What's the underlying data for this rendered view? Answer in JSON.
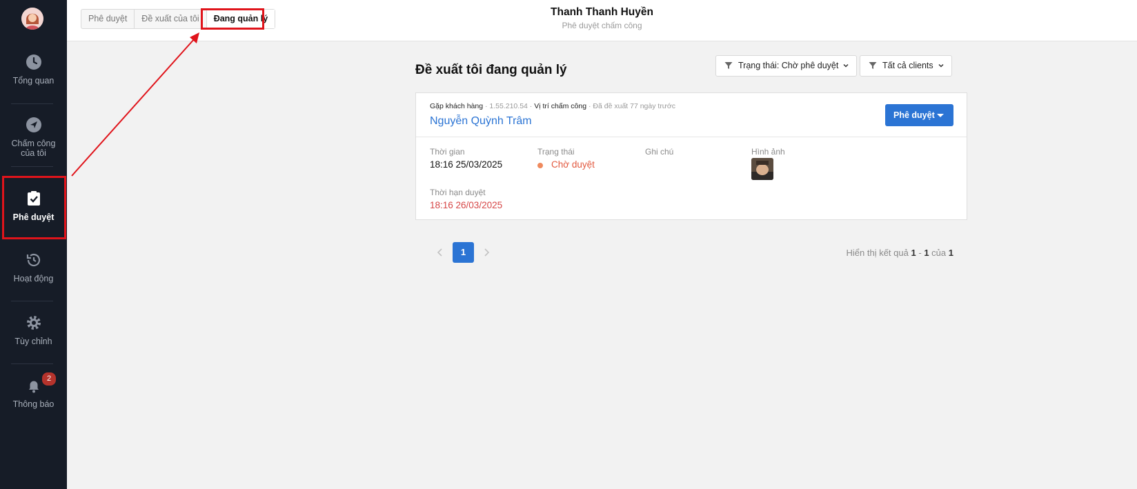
{
  "sidebar": {
    "items": [
      {
        "label": "Tổng quan",
        "icon": "clock-icon"
      },
      {
        "label": "Chấm công của tôi",
        "icon": "navigation-icon"
      },
      {
        "label": "Phê duyệt",
        "icon": "clipboard-check-icon"
      },
      {
        "label": "Hoạt động",
        "icon": "history-icon"
      },
      {
        "label": "Tùy chỉnh",
        "icon": "gear-icon"
      },
      {
        "label": "Thông báo",
        "icon": "bell-icon"
      }
    ],
    "notification_count": "2"
  },
  "header": {
    "tabs": [
      {
        "label": "Phê duyệt"
      },
      {
        "label": "Đề xuất của tôi"
      },
      {
        "label": "Đang quản lý"
      }
    ],
    "user_name": "Thanh Thanh Huyền",
    "user_subtitle": "Phê duyệt chấm công"
  },
  "main": {
    "title": "Đề xuất tôi đang quản lý",
    "filters": {
      "status": "Trạng thái: Chờ phê duyệt",
      "clients": "Tất cả clients"
    },
    "card": {
      "category": "Gặp khách hàng",
      "ip": "· 1.55.210.54 ·",
      "location": "Vị trí chấm công",
      "proposed": "· Đã đề xuất 77 ngày trước",
      "person": "Nguyễn Quỳnh Trâm",
      "approve_label": "Phê duyệt",
      "time_label": "Thời gian",
      "time_value": "18:16 25/03/2025",
      "status_label": "Trạng thái",
      "status_value": "Chờ duyệt",
      "note_label": "Ghi chú",
      "image_label": "Hình ảnh",
      "deadline_label": "Thời hạn duyệt",
      "deadline_value": "18:16 26/03/2025"
    },
    "pagination": {
      "current": "1",
      "result_prefix": "Hiển thị kết quả",
      "from": "1",
      "sep": "-",
      "to": "1",
      "of_label": "của",
      "total": "1"
    }
  },
  "colors": {
    "sidebar_bg": "#161c27",
    "accent": "#2b74d4",
    "highlight": "#e0141b",
    "status_orange": "#e2583e",
    "deadline_red": "#d64545"
  }
}
